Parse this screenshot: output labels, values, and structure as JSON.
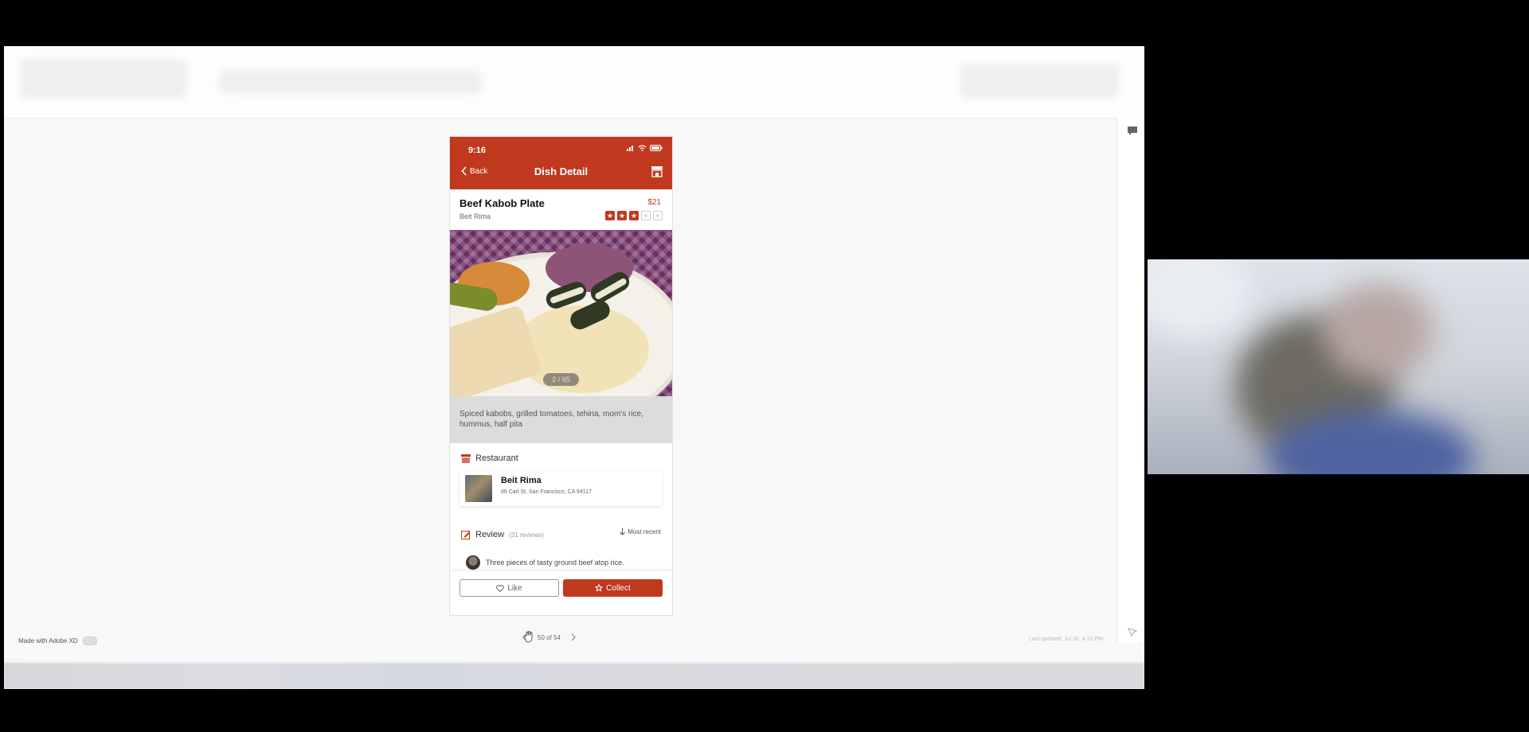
{
  "viewer": {
    "footer_left": "Made with Adobe XD",
    "footer_right": "Last updated: Jul 30, 4:15 PM",
    "pager_text": "50 of 54"
  },
  "phone": {
    "status_time": "9:16",
    "nav": {
      "back_label": "Back",
      "title": "Dish Detail"
    },
    "dish": {
      "name": "Beef Kabob Plate",
      "restaurant": "Beit Rima",
      "price": "$21",
      "rating": 3,
      "rating_max": 5
    },
    "photo_counter": "2 / 65",
    "description": "Spiced kabobs, grilled tomatoes, tehina, mom's rice, hummus, half pita",
    "restaurant_section": {
      "title": "Restaurant",
      "name": "Beit Rima",
      "address": "86 Carl St, San Francisco, CA 94117"
    },
    "review_section": {
      "title": "Review",
      "count_text": "(31 reviews)",
      "sort_label": "Most recent",
      "first_review": "Three pieces of tasty ground beef atop rice."
    },
    "actions": {
      "like_label": "Like",
      "collect_label": "Collect"
    }
  },
  "colors": {
    "brand": "#c0391e",
    "background": "#f8f8f8"
  },
  "icons": [
    "chevron-left-icon",
    "store-icon",
    "star-icon",
    "edit-icon",
    "heart-icon",
    "comment-icon",
    "hand-cursor-icon"
  ]
}
